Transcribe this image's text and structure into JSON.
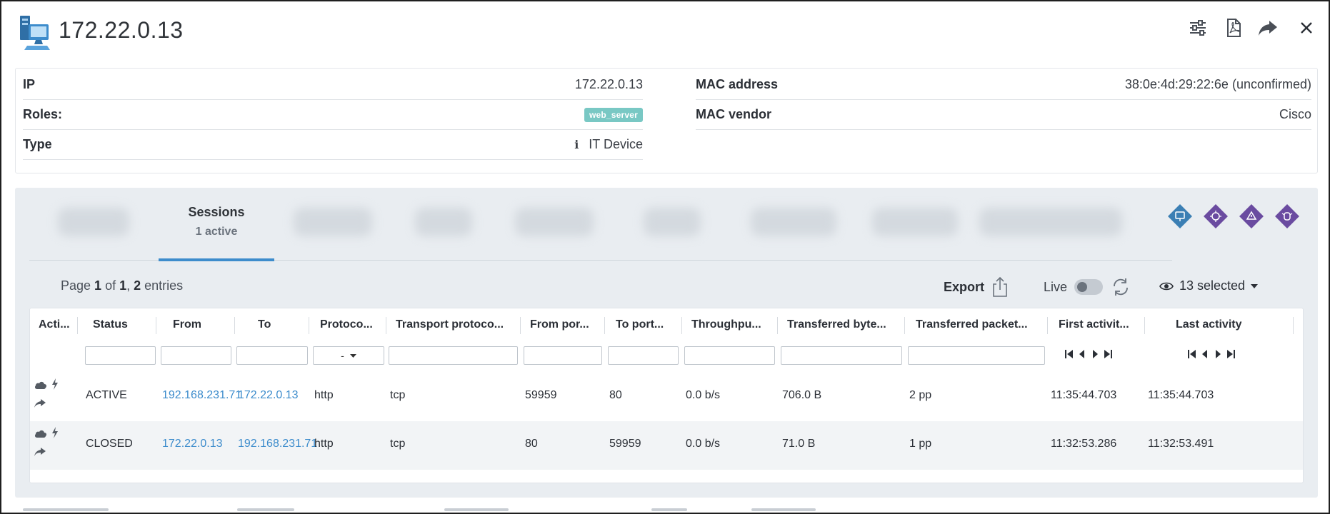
{
  "header": {
    "title": "172.22.0.13",
    "icons": [
      "device-icon",
      "settings-sliders-icon",
      "pdf-icon",
      "share-icon",
      "close-icon"
    ]
  },
  "info": {
    "ip_label": "IP",
    "ip_value": "172.22.0.13",
    "roles_label": "Roles:",
    "roles_value": "web_server",
    "type_label": "Type",
    "type_value": "IT Device",
    "mac_label": "MAC address",
    "mac_value": "38:0e:4d:29:22:6e (unconfirmed)",
    "vendor_label": "MAC vendor",
    "vendor_value": "Cisco"
  },
  "tabs": {
    "active_label": "Sessions",
    "active_sub": "1 active"
  },
  "toolbar": {
    "page_prefix": "Page ",
    "page_num": "1",
    "page_of": " of ",
    "page_total": "1",
    "page_comma": ", ",
    "entries_count": "2",
    "entries_suffix": " entries",
    "export_label": "Export",
    "live_label": "Live",
    "selected_label": "13 selected"
  },
  "table": {
    "columns": [
      "Acti...",
      "Status",
      "From",
      "To",
      "Protoco...",
      "Transport protoco...",
      "From por...",
      "To port...",
      "Throughpu...",
      "Transferred byte...",
      "Transferred packet...",
      "First activit...",
      "Last activity"
    ],
    "protocol_filter": "-",
    "rows": [
      {
        "status": "ACTIVE",
        "from": "192.168.231.71",
        "to": "172.22.0.13",
        "protocol": "http",
        "transport": "tcp",
        "from_port": "59959",
        "to_port": "80",
        "throughput": "0.0 b/s",
        "bytes": "706.0 B",
        "packets": "2 pp",
        "first": "11:35:44.703",
        "last": "11:35:44.703"
      },
      {
        "status": "CLOSED",
        "from": "172.22.0.13",
        "to": "192.168.231.71",
        "protocol": "http",
        "transport": "tcp",
        "from_port": "80",
        "to_port": "59959",
        "throughput": "0.0 b/s",
        "bytes": "71.0 B",
        "packets": "1 pp",
        "first": "11:32:53.286",
        "last": "11:32:53.491"
      }
    ]
  },
  "colors": {
    "accent": "#3d8ccc",
    "badge": "#79c8c4",
    "diamond_blue": "#3b7fb4",
    "diamond_purple": "#6a4ba0"
  }
}
